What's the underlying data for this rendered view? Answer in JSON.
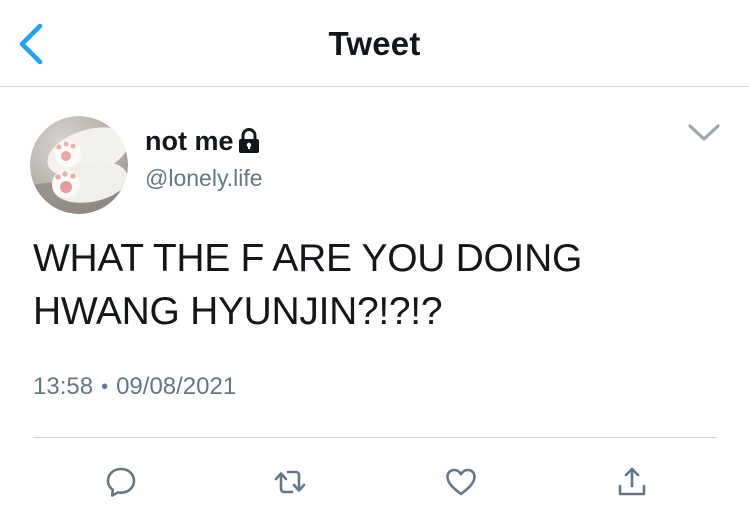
{
  "header": {
    "title": "Tweet",
    "back_icon": "chevron-left-icon",
    "accent_color": "#1da1f2"
  },
  "tweet": {
    "author": {
      "display_name": "not me",
      "handle": "@lonely.life",
      "protected_icon": "lock-icon",
      "avatar": "cat-paws-photo"
    },
    "menu_icon": "chevron-down-icon",
    "text_lines": [
      "WHAT THE F ARE YOU DOING",
      "HWANG HYUNJIN?!?!?"
    ],
    "time": "13:58",
    "separator": "•",
    "date": "09/08/2021"
  },
  "actions": [
    {
      "name": "reply",
      "icon": "reply-icon"
    },
    {
      "name": "retweet",
      "icon": "retweet-icon"
    },
    {
      "name": "like",
      "icon": "heart-icon"
    },
    {
      "name": "share",
      "icon": "share-icon"
    }
  ],
  "colors": {
    "text_primary": "#14171a",
    "text_secondary": "#657786",
    "divider": "#cfd4d8"
  }
}
